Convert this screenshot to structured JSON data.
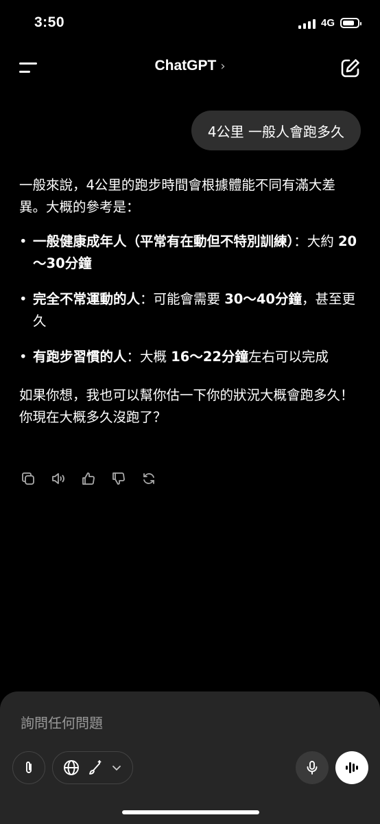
{
  "status": {
    "time": "3:50",
    "network": "4G",
    "signal_bars": 4,
    "battery_level": 0.8
  },
  "header": {
    "title": "ChatGPT",
    "chevron": "›"
  },
  "conversation": {
    "user_message": "4公里 一般人會跑多久",
    "assistant": {
      "intro": "一般來說，4公里的跑步時間會根據體能不同有滿大差異。大概的參考是：",
      "bullets": [
        {
          "bold": "一般健康成年人（平常有在動但不特別訓練）",
          "text1": "：大約 ",
          "bold2": "20～30分鐘",
          "text2": ""
        },
        {
          "bold": "完全不常運動的人",
          "text1": "：可能會需要 ",
          "bold2": "30～40分鐘",
          "text2": "，甚至更久"
        },
        {
          "bold": "有跑步習慣的人",
          "text1": "：大概 ",
          "bold2": "16～22分鐘",
          "text2": "左右可以完成"
        }
      ],
      "outro": "如果你想，我也可以幫你估一下你的狀況大概會跑多久！你現在大概多久沒跑了？"
    },
    "actions": [
      "copy-icon",
      "speaker-icon",
      "thumbs-up-icon",
      "thumbs-down-icon",
      "regenerate-icon"
    ]
  },
  "composer": {
    "placeholder": "詢問任何問題",
    "icons": [
      "paperclip-icon",
      "globe-icon",
      "brush-icon",
      "chevron-down-icon",
      "microphone-icon",
      "voice-wave-icon"
    ]
  },
  "colors": {
    "background": "#000000",
    "bubble": "#2f2f2f",
    "composer": "#262626",
    "text": "#ffffff",
    "muted": "#999999"
  }
}
